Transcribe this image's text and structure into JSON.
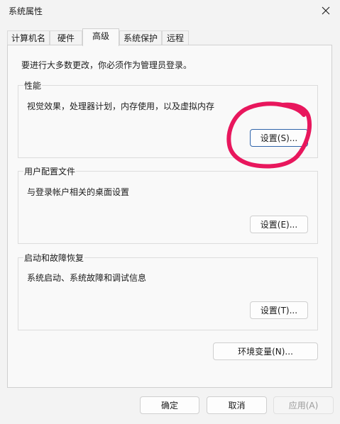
{
  "window": {
    "title": "系统属性",
    "close_icon": "close-icon"
  },
  "tabs": [
    {
      "label": "计算机名",
      "active": false
    },
    {
      "label": "硬件",
      "active": false
    },
    {
      "label": "高级",
      "active": true
    },
    {
      "label": "系统保护",
      "active": false
    },
    {
      "label": "远程",
      "active": false
    }
  ],
  "advanced": {
    "admin_note": "要进行大多数更改，你必须作为管理员登录。",
    "performance": {
      "title": "性能",
      "description": "视觉效果，处理器计划，内存使用，以及虚拟内存",
      "button": "设置(S)..."
    },
    "user_profiles": {
      "title": "用户配置文件",
      "description": "与登录帐户相关的桌面设置",
      "button": "设置(E)..."
    },
    "startup_recovery": {
      "title": "启动和故障恢复",
      "description": "系统启动、系统故障和调试信息",
      "button": "设置(T)..."
    },
    "env_button": "环境变量(N)..."
  },
  "footer": {
    "ok": "确定",
    "cancel": "取消",
    "apply": "应用(A)"
  },
  "colors": {
    "annotation_stroke": "#e8175d",
    "focus_border": "#2e63a9"
  }
}
